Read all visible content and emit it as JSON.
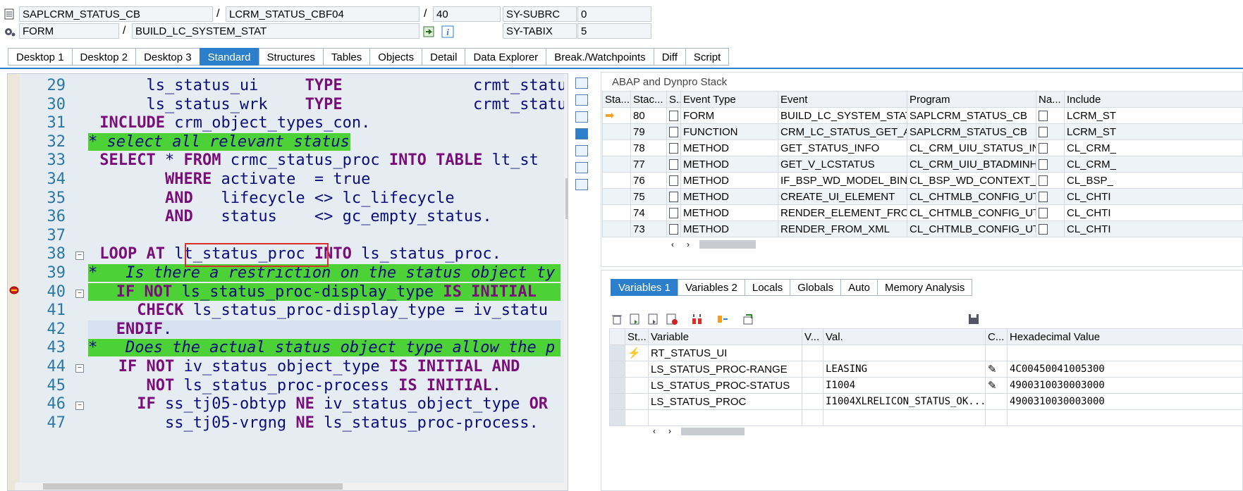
{
  "header": {
    "program": "SAPLCRM_STATUS_CB",
    "include": "LCRM_STATUS_CBF04",
    "line": "40",
    "event_type": "FORM",
    "event": "BUILD_LC_SYSTEM_STAT",
    "sy_subrc_label": "SY-SUBRC",
    "sy_subrc_value": "0",
    "sy_tabix_label": "SY-TABIX",
    "sy_tabix_value": "5",
    "slash": "/"
  },
  "tabs": [
    "Desktop 1",
    "Desktop 2",
    "Desktop 3",
    "Standard",
    "Structures",
    "Tables",
    "Objects",
    "Detail",
    "Data Explorer",
    "Break./Watchpoints",
    "Diff",
    "Script"
  ],
  "active_tab": "Standard",
  "editor": {
    "lines": [
      {
        "num": "29",
        "text": "      ls_status_ui     TYPE              crmt_statu"
      },
      {
        "num": "30",
        "text": "      ls_status_wrk    TYPE              crmt_statu"
      },
      {
        "num": "31",
        "text": " INCLUDE crm_object_types_con."
      },
      {
        "num": "32",
        "text": "* select all relevant status"
      },
      {
        "num": "33",
        "text": " SELECT * FROM crmc_status_proc INTO TABLE lt_st"
      },
      {
        "num": "34",
        "text": "        WHERE activate  = true"
      },
      {
        "num": "35",
        "text": "        AND   lifecycle <> lc_lifecycle"
      },
      {
        "num": "36",
        "text": "        AND   status    <> gc_empty_status."
      },
      {
        "num": "37",
        "text": ""
      },
      {
        "num": "38",
        "text": " LOOP AT lt_status_proc INTO ls_status_proc."
      },
      {
        "num": "39",
        "text": "*   Is there a restriction on the status object ty"
      },
      {
        "num": "40",
        "text": "   IF NOT ls_status_proc-display_type IS INITIAL"
      },
      {
        "num": "41",
        "text": "     CHECK ls_status_proc-display_type = iv_statu"
      },
      {
        "num": "42",
        "text": "   ENDIF."
      },
      {
        "num": "43",
        "text": "*   Does the actual status object type allow the p"
      },
      {
        "num": "44",
        "text": "   IF NOT iv_status_object_type IS INITIAL AND"
      },
      {
        "num": "45",
        "text": "      NOT ls_status_proc-process IS INITIAL."
      },
      {
        "num": "46",
        "text": "     IF ss_tj05-obtyp NE iv_status_object_type OR"
      },
      {
        "num": "47",
        "text": "        ss_tj05-vrgng NE ls_status_proc-process."
      }
    ]
  },
  "stack": {
    "title": "ABAP and Dynpro Stack",
    "columns": [
      "Sta...",
      "Stac...",
      "S..",
      "Event Type",
      "Event",
      "Program",
      "Na...",
      "Include"
    ],
    "rows": [
      {
        "level": "80",
        "type": "FORM",
        "event": "BUILD_LC_SYSTEM_STAT",
        "program": "SAPLCRM_STATUS_CB",
        "include": "LCRM_ST"
      },
      {
        "level": "79",
        "type": "FUNCTION",
        "event": "CRM_LC_STATUS_GET_AT...",
        "program": "SAPLCRM_STATUS_CB",
        "include": "LCRM_ST"
      },
      {
        "level": "78",
        "type": "METHOD",
        "event": "GET_STATUS_INFO",
        "program": "CL_CRM_UIU_STATUS_INF...",
        "include": "CL_CRM_"
      },
      {
        "level": "77",
        "type": "METHOD",
        "event": "GET_V_LCSTATUS",
        "program": "CL_CRM_UIU_BTADMINH_...",
        "include": "CL_CRM_"
      },
      {
        "level": "76",
        "type": "METHOD",
        "event": "IF_BSP_WD_MODEL_BINDI...",
        "program": "CL_BSP_WD_CONTEXT_N...",
        "include": "CL_BSP_"
      },
      {
        "level": "75",
        "type": "METHOD",
        "event": "CREATE_UI_ELEMENT",
        "program": "CL_CHTMLB_CONFIG_UTIL...",
        "include": "CL_CHTI"
      },
      {
        "level": "74",
        "type": "METHOD",
        "event": "RENDER_ELEMENT_FROM_...",
        "program": "CL_CHTMLB_CONFIG_UTIL...",
        "include": "CL_CHTI"
      },
      {
        "level": "73",
        "type": "METHOD",
        "event": "RENDER_FROM_XML",
        "program": "CL_CHTMLB_CONFIG_UTIL...",
        "include": "CL_CHTI"
      }
    ]
  },
  "variables": {
    "tabs": [
      "Variables 1",
      "Variables 2",
      "Locals",
      "Globals",
      "Auto",
      "Memory Analysis"
    ],
    "active_tab": "Variables 1",
    "columns": [
      "St...",
      "Variable",
      "V...",
      "Val.",
      "C...",
      "Hexadecimal Value"
    ],
    "rows": [
      {
        "variable": "RT_STATUS_UI",
        "value": "",
        "hex": ""
      },
      {
        "variable": "LS_STATUS_PROC-RANGE",
        "value": "LEASING",
        "hex": "4C00450041005300"
      },
      {
        "variable": "LS_STATUS_PROC-STATUS",
        "value": "I1004",
        "hex": "4900310030003000"
      },
      {
        "variable": "LS_STATUS_PROC",
        "value": "I1004XLRELICON_STATUS_OK...",
        "hex": "4900310030003000"
      }
    ]
  },
  "colors": {
    "accent": "#2c7fca",
    "comment_bg": "#4cd137",
    "highlight_box": "#d9302c"
  }
}
